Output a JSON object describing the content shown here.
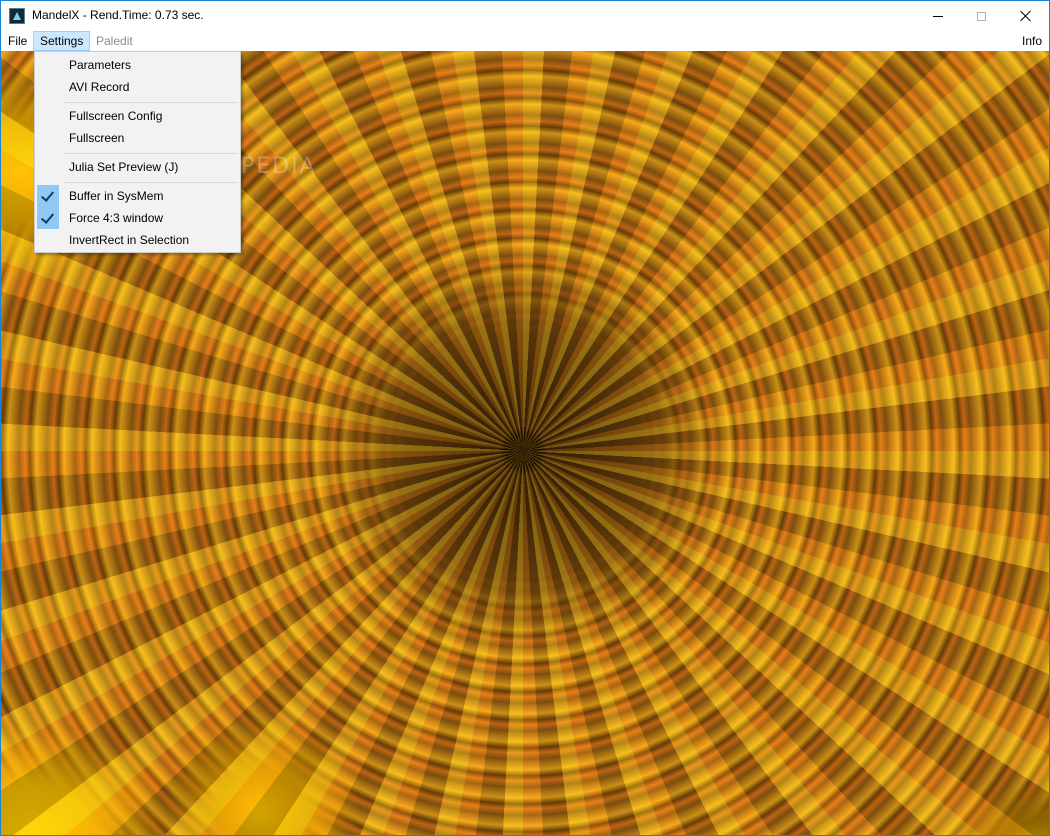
{
  "window": {
    "title": "MandelX - Rend.Time:  0.73 sec."
  },
  "menubar": {
    "file": "File",
    "settings": "Settings",
    "paledit": "Paledit",
    "info": "Info"
  },
  "settings_menu": {
    "items": [
      {
        "label": "Parameters",
        "checked": false
      },
      {
        "label": "AVI Record",
        "checked": false
      },
      {
        "label": "Fullscreen Config",
        "checked": false
      },
      {
        "label": "Fullscreen",
        "checked": false
      },
      {
        "label": "Julia Set Preview (J)",
        "checked": false
      },
      {
        "label": "Buffer in SysMem",
        "checked": true
      },
      {
        "label": "Force 4:3 window",
        "checked": true
      },
      {
        "label": "InvertRect in Selection",
        "checked": false
      }
    ]
  },
  "watermark": "SOFTPEDIA",
  "colors": {
    "menu_highlight": "#cce8ff",
    "check_background": "#90c8f6",
    "fractal_gold": "#f2b31e",
    "fractal_orange": "#e07a1c"
  },
  "icons": {
    "app": "mandelx-app-icon",
    "minimize": "minimize-icon",
    "maximize": "maximize-icon",
    "close": "close-icon",
    "check": "checkmark-icon"
  }
}
